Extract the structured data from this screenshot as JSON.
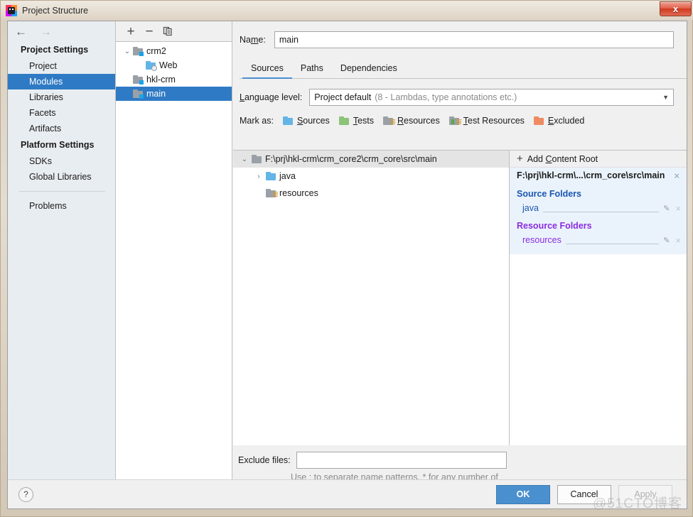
{
  "window": {
    "title": "Project Structure",
    "icon": "intellij-idea-icon",
    "close_label": "x"
  },
  "nav": {
    "back": "←",
    "forward": "→"
  },
  "sidebar": {
    "groups": [
      {
        "label": "Project Settings",
        "items": [
          {
            "label": "Project",
            "selected": false
          },
          {
            "label": "Modules",
            "selected": true
          },
          {
            "label": "Libraries",
            "selected": false
          },
          {
            "label": "Facets",
            "selected": false
          },
          {
            "label": "Artifacts",
            "selected": false
          }
        ]
      },
      {
        "label": "Platform Settings",
        "items": [
          {
            "label": "SDKs",
            "selected": false
          },
          {
            "label": "Global Libraries",
            "selected": false
          }
        ]
      }
    ],
    "problems": {
      "label": "Problems"
    }
  },
  "modules_toolbar": {
    "add": "+",
    "remove": "−",
    "copy": "copy-icon"
  },
  "modules_tree": [
    {
      "label": "crm2",
      "indent": 0,
      "twisty": "⌄",
      "icon": "module-folder",
      "selected": false
    },
    {
      "label": "Web",
      "indent": 2,
      "twisty": "",
      "icon": "web-facet",
      "selected": false
    },
    {
      "label": "hkl-crm",
      "indent": 1,
      "twisty": "",
      "icon": "module-folder",
      "selected": false
    },
    {
      "label": "main",
      "indent": 1,
      "twisty": "",
      "icon": "module-folder",
      "selected": true
    }
  ],
  "detail": {
    "name_label_pre": "Na",
    "name_label_mnemonic": "m",
    "name_label_post": "e:",
    "name_value": "main",
    "tabs": [
      {
        "label": "Sources",
        "active": true
      },
      {
        "label": "Paths",
        "active": false
      },
      {
        "label": "Dependencies",
        "active": false
      }
    ],
    "language_level": {
      "label_mnemonic": "L",
      "label_rest": "anguage level:",
      "value": "Project default",
      "value_detail": "(8 - Lambdas, type annotations etc.)",
      "arrow": "▼"
    },
    "mark_as": {
      "label": "Mark as:",
      "options": [
        {
          "label": "Sources",
          "mnemonic": "S",
          "rest": "ources",
          "color": "blue"
        },
        {
          "label": "Tests",
          "mnemonic": "T",
          "rest": "ests",
          "color": "green"
        },
        {
          "label": "Resources",
          "mnemonic": "R",
          "rest": "esources",
          "color": "gray-lines"
        },
        {
          "label": "Test Resources",
          "mnemonic": "T",
          "rest": "est Resources",
          "color": "green-lines"
        },
        {
          "label": "Excluded",
          "mnemonic": "E",
          "rest": "xcluded",
          "color": "orange"
        }
      ]
    },
    "roots_tree": [
      {
        "label": "F:\\prj\\hkl-crm\\crm_core2\\crm_core\\src\\main",
        "indent": 0,
        "twisty": "⌄",
        "icon": "gray-folder",
        "header": true
      },
      {
        "label": "java",
        "indent": 1,
        "twisty": "›",
        "icon": "blue-folder",
        "header": false
      },
      {
        "label": "resources",
        "indent": 1,
        "twisty": "",
        "icon": "resources-folder",
        "header": false
      }
    ],
    "roots_side": {
      "add_content_root_pre": "Add ",
      "add_content_root_mnemonic": "C",
      "add_content_root_post": "ontent Root",
      "plus": "+",
      "content_root_path": "F:\\prj\\hkl-crm\\...\\crm_core\\src\\main",
      "close": "×",
      "source_folders_title": "Source Folders",
      "source_folders": [
        {
          "name": "java"
        }
      ],
      "resource_folders_title": "Resource Folders",
      "resource_folders": [
        {
          "name": "resources"
        }
      ],
      "pencil": "✎",
      "remove": "×"
    },
    "exclude": {
      "label": "Exclude files:",
      "value": "",
      "hint": "Use ; to separate name patterns, * for any number of symbols, ? for one."
    }
  },
  "footer": {
    "help": "?",
    "ok": "OK",
    "cancel": "Cancel",
    "apply": "Apply"
  },
  "watermark": "@51CTO博客",
  "colors": {
    "selection_blue": "#2f7ac4",
    "primary_button": "#4a90cf",
    "source_folder_blue": "#1a56b0",
    "resource_folder_purple": "#8a2be2",
    "content_root_bg": "#eaf3fb",
    "close_button_red": "#cf3a20"
  }
}
